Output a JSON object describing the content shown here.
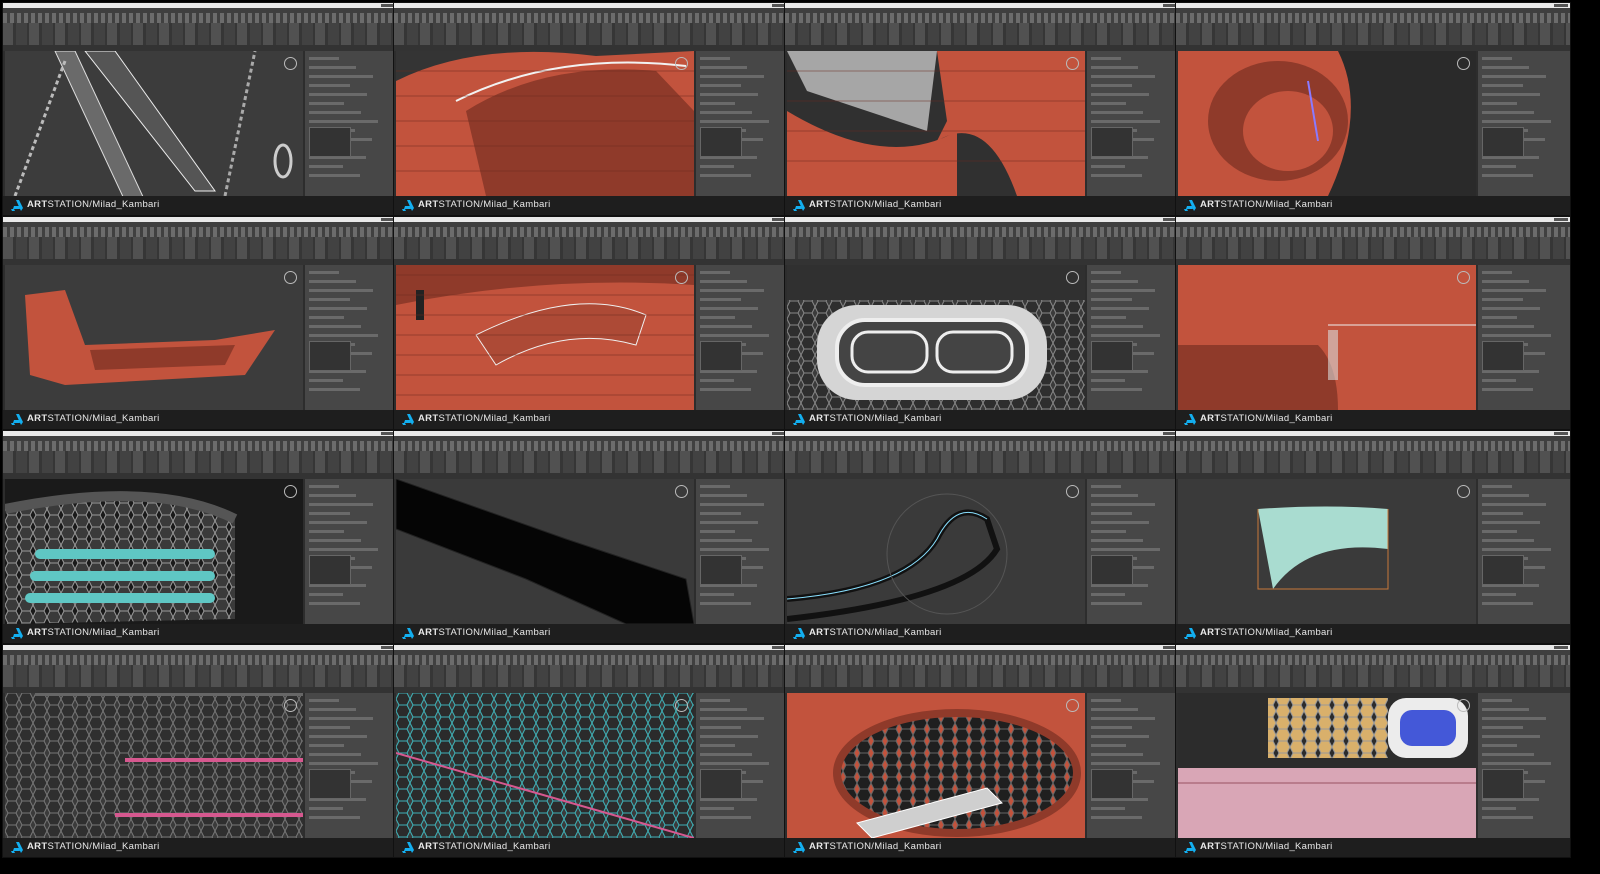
{
  "watermark": {
    "brand_bold": "ART",
    "brand_rest": "STATION",
    "path": "/Milad_Kambari"
  },
  "tiles": [
    {
      "scene": "wireframe-gray"
    },
    {
      "scene": "orange-surface-arch"
    },
    {
      "scene": "orange-surface-wing"
    },
    {
      "scene": "orange-bumper-front"
    },
    {
      "scene": "orange-body-side"
    },
    {
      "scene": "orange-mesh-dense"
    },
    {
      "scene": "grille-vent-closeup"
    },
    {
      "scene": "orange-panel-flat"
    },
    {
      "scene": "dark-grille-cyan"
    },
    {
      "scene": "black-strip"
    },
    {
      "scene": "outline-curve"
    },
    {
      "scene": "mint-surface"
    },
    {
      "scene": "hex-mesh-pink"
    },
    {
      "scene": "hex-mesh-cyan"
    },
    {
      "scene": "orange-grille-inset"
    },
    {
      "scene": "grille-colored-parts"
    }
  ],
  "colors": {
    "orange": "#c2533d",
    "orange_dark": "#8f3a2a",
    "viewport_gray": "#3b3b3b",
    "cyan": "#5fc7c4",
    "pink": "#d6588f",
    "mint": "#a9dcd0"
  }
}
